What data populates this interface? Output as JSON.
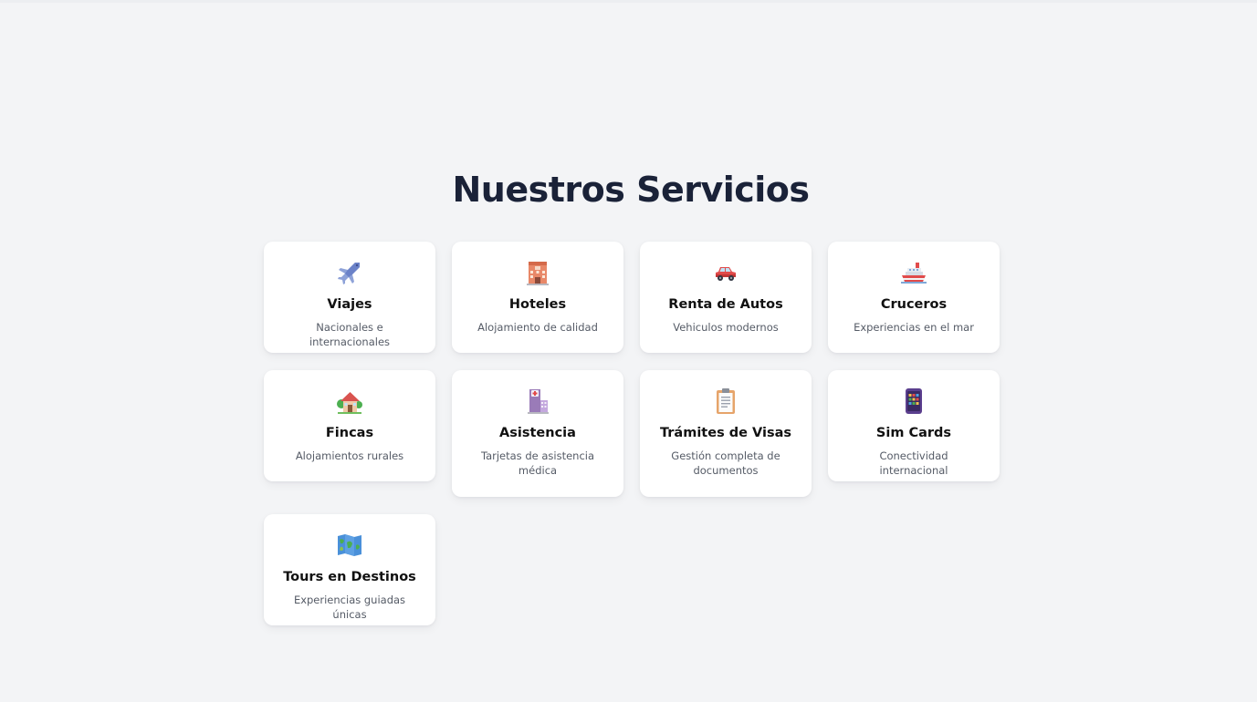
{
  "section": {
    "title": "Nuestros Servicios"
  },
  "services": [
    {
      "title": "Viajes",
      "desc": "Nacionales e internacionales",
      "icon": "airplane-icon"
    },
    {
      "title": "Hoteles",
      "desc": "Alojamiento de calidad",
      "icon": "hotel-icon"
    },
    {
      "title": "Renta de Autos",
      "desc": "Vehiculos modernos",
      "icon": "car-icon"
    },
    {
      "title": "Cruceros",
      "desc": "Experiencias en el mar",
      "icon": "ship-icon"
    },
    {
      "title": "Fincas",
      "desc": "Alojamientos rurales",
      "icon": "house-icon"
    },
    {
      "title": "Asistencia",
      "desc": "Tarjetas de asistencia médica",
      "icon": "hospital-icon"
    },
    {
      "title": "Trámites de Visas",
      "desc": "Gestión completa de documentos",
      "icon": "clipboard-icon"
    },
    {
      "title": "Sim Cards",
      "desc": "Conectividad internacional",
      "icon": "phone-icon"
    },
    {
      "title": "Tours en Destinos",
      "desc": "Experiencias guiadas únicas",
      "icon": "map-icon"
    }
  ]
}
